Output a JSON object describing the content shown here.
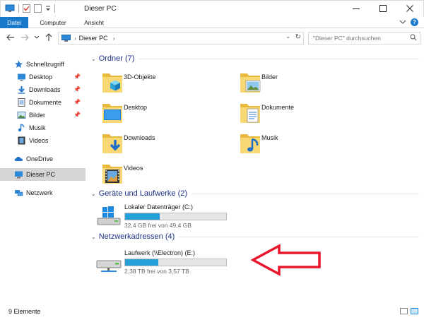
{
  "window": {
    "title": "Dieser PC",
    "controls": [
      "minimize",
      "maximize",
      "close"
    ]
  },
  "ribbon": {
    "tabs": [
      "Datei",
      "Computer",
      "Ansicht"
    ]
  },
  "address": {
    "path": "Dieser PC",
    "search_placeholder": "\"Dieser PC\" durchsuchen"
  },
  "sidebar": {
    "quick_access": "Schnellzugriff",
    "quick_items": [
      {
        "label": "Desktop",
        "pinned": true,
        "icon": "desktop-icon"
      },
      {
        "label": "Downloads",
        "pinned": true,
        "icon": "download-icon"
      },
      {
        "label": "Dokumente",
        "pinned": true,
        "icon": "documents-icon"
      },
      {
        "label": "Bilder",
        "pinned": true,
        "icon": "pictures-icon"
      },
      {
        "label": "Musik",
        "pinned": false,
        "icon": "music-icon"
      },
      {
        "label": "Videos",
        "pinned": false,
        "icon": "videos-icon"
      }
    ],
    "onedrive": "OneDrive",
    "this_pc": "Dieser PC",
    "network": "Netzwerk"
  },
  "main": {
    "folders_header": "Ordner (7)",
    "folders": [
      {
        "name": "3D-Objekte",
        "icon": "3d-objects-icon"
      },
      {
        "name": "Bilder",
        "icon": "pictures-folder-icon"
      },
      {
        "name": "Desktop",
        "icon": "desktop-folder-icon"
      },
      {
        "name": "Dokumente",
        "icon": "documents-folder-icon"
      },
      {
        "name": "Downloads",
        "icon": "downloads-folder-icon"
      },
      {
        "name": "Musik",
        "icon": "music-folder-icon"
      },
      {
        "name": "Videos",
        "icon": "videos-folder-icon"
      }
    ],
    "devices_header": "Geräte und Laufwerke (2)",
    "local_drive": {
      "name": "Lokaler Datenträger (C:)",
      "free_text": "32,4 GB frei von 49,4 GB",
      "used_fraction": 0.34
    },
    "network_header": "Netzwerkadressen (4)",
    "network_drive": {
      "name": "Laufwerk (\\\\Electron) (E:)",
      "free_text": "2,38 TB frei von 3,57 TB",
      "used_fraction": 0.33
    }
  },
  "status": {
    "count": "9 Elemente"
  },
  "colors": {
    "accent": "#1979ca",
    "section_text": "#1e3287",
    "bar_fill": "#26a0da",
    "folder_yellow": "#f8d775",
    "arrow_red": "#e8192c"
  }
}
